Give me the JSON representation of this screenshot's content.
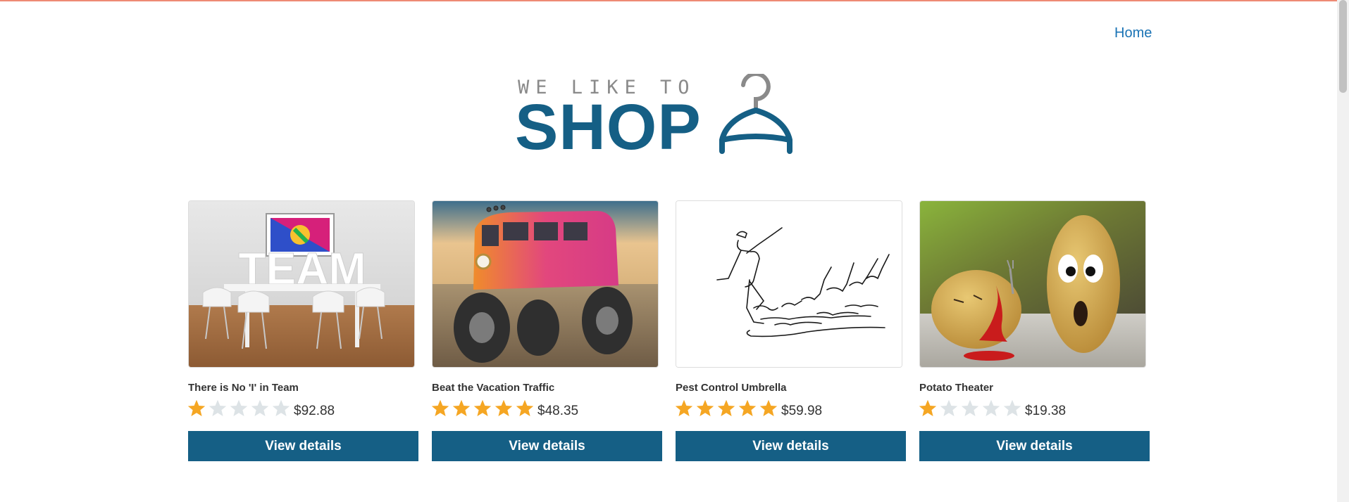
{
  "nav": {
    "home_label": "Home"
  },
  "logo": {
    "tagline": "WE LIKE TO",
    "word": "SHOP",
    "icon": "hanger-icon",
    "word_color": "#155f85",
    "tagline_color": "#8a8a8a"
  },
  "colors": {
    "accent": "#155f85",
    "star_filled": "#f5a623",
    "star_empty": "#dde3e6",
    "top_border": "#ee8a74",
    "nav_link": "#1a73b5"
  },
  "products": [
    {
      "title": "There is No 'I' in Team",
      "rating": 1,
      "rating_max": 5,
      "price": "$92.88",
      "button_label": "View details",
      "image": "team-room-image"
    },
    {
      "title": "Beat the Vacation Traffic",
      "rating": 5,
      "rating_max": 5,
      "price": "$48.35",
      "button_label": "View details",
      "image": "monster-bus-image"
    },
    {
      "title": "Pest Control Umbrella",
      "rating": 5,
      "rating_max": 5,
      "price": "$59.98",
      "button_label": "View details",
      "image": "pied-piper-sketch-image"
    },
    {
      "title": "Potato Theater",
      "rating": 1,
      "rating_max": 5,
      "price": "$19.38",
      "button_label": "View details",
      "image": "potato-scene-image"
    }
  ]
}
